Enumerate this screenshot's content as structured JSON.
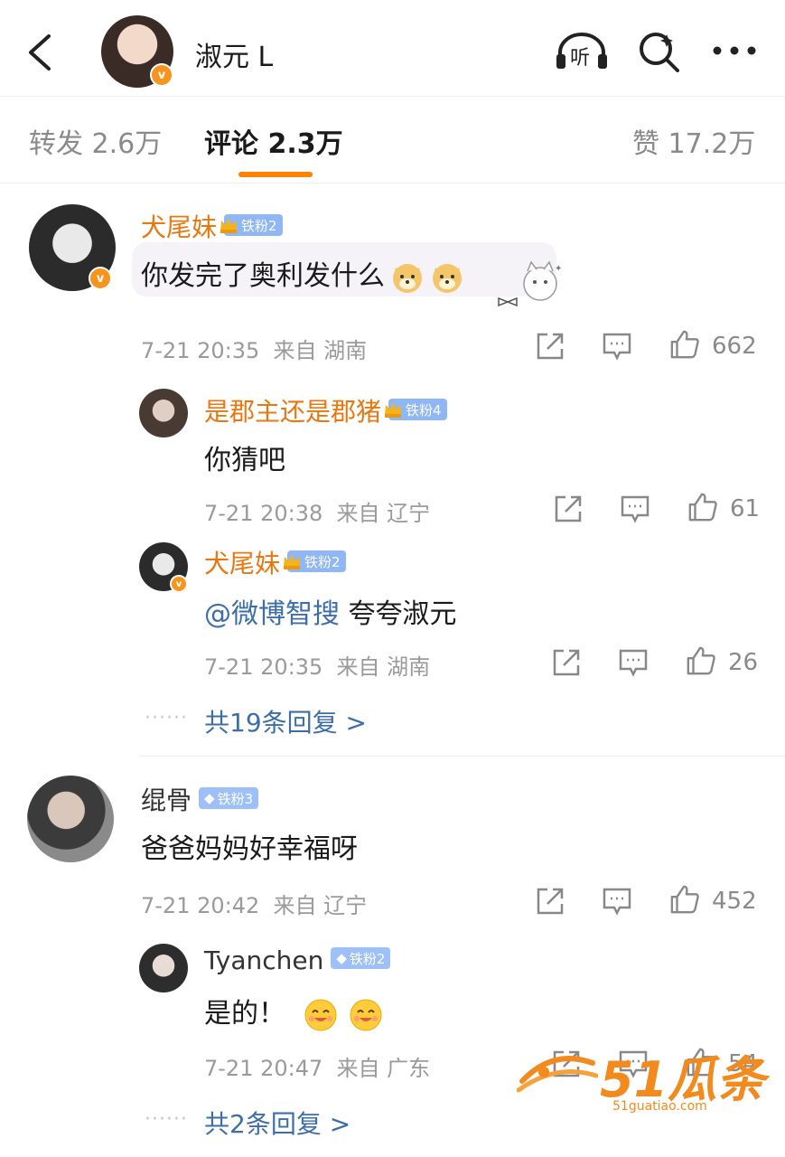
{
  "header": {
    "title": "淑元 L",
    "listen_label": "听",
    "icons": [
      "back-arrow-icon",
      "listen-headphones-icon",
      "search-icon",
      "more-icon"
    ]
  },
  "tabs": [
    {
      "label": "转发 2.6万"
    },
    {
      "label": "评论 2.3万"
    },
    {
      "label": "赞 17.2万"
    }
  ],
  "comments": [
    {
      "user": "犬尾妹",
      "fan_badge": "铁粉2",
      "text": "你发完了奥利发什么",
      "time": "7-21 20:35",
      "from_label": "来自",
      "location": "湖南",
      "likes": "662",
      "replies": [
        {
          "user": "是郡主还是郡猪",
          "fan_badge": "铁粉4",
          "text": "你猜吧",
          "time": "7-21 20:38",
          "from_label": "来自",
          "location": "辽宁",
          "likes": "61"
        },
        {
          "user": "犬尾妹",
          "fan_badge": "铁粉2",
          "mention": "@微博智搜",
          "text": "夸夸淑元",
          "time": "7-21 20:35",
          "from_label": "来自",
          "location": "湖南",
          "likes": "26"
        }
      ],
      "more_replies": "共19条回复 >"
    },
    {
      "user": "绲骨",
      "fan_badge": "铁粉3",
      "text": "爸爸妈妈好幸福呀",
      "time": "7-21 20:42",
      "from_label": "来自",
      "location": "辽宁",
      "likes": "452",
      "replies": [
        {
          "user": "Tyanchen",
          "fan_badge": "铁粉2",
          "text": "是的！",
          "time": "7-21 20:47",
          "from_label": "来自",
          "location": "广东",
          "likes": "54"
        }
      ],
      "more_replies": "共2条回复 >"
    }
  ],
  "watermark": {
    "brand": "51瓜条",
    "url": "51guatiao.com"
  },
  "colors": {
    "accent": "#ff8200",
    "username": "#e8770f",
    "link": "#3d6ea8",
    "fan_badge": "#8fb6f5"
  }
}
